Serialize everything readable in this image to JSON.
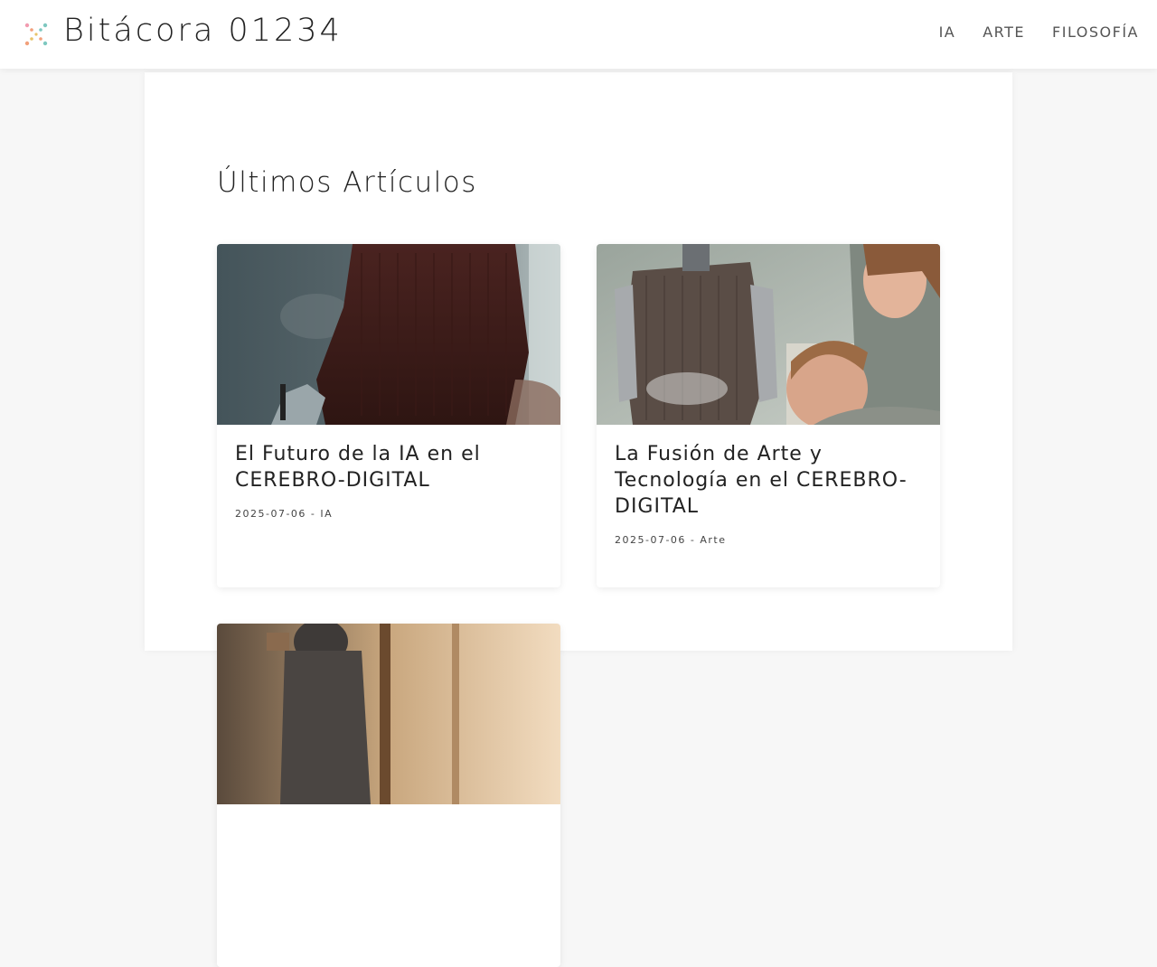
{
  "header": {
    "site_title": "Bitácora 01234",
    "logo_icon": "sparkle-dots-icon",
    "nav": [
      {
        "label": "IA"
      },
      {
        "label": "ARTE"
      },
      {
        "label": "FILOSOFÍA"
      }
    ]
  },
  "main": {
    "section_title": "Últimos Artículos",
    "articles": [
      {
        "title": "El Futuro de la IA en el CEREBRO-DIGITAL",
        "date": "2025-07-06",
        "category": "IA",
        "meta": "2025-07-06 - IA",
        "image": "robot-hand-sweater-photo"
      },
      {
        "title": "La Fusión de Arte y Tecnología en el CEREBRO-DIGITAL",
        "date": "2025-07-06",
        "category": "Arte",
        "meta": "2025-07-06 - Arte",
        "image": "robot-woman-child-photo"
      },
      {
        "image": "robot-window-photo"
      }
    ]
  },
  "colors": {
    "page_background": "#f7f7f7",
    "card_background": "#ffffff",
    "text": "#222222",
    "nav_text": "#555555",
    "logo_dots": [
      "#f2a07b",
      "#7ec8c0",
      "#e8c46a",
      "#f29bb0"
    ]
  }
}
